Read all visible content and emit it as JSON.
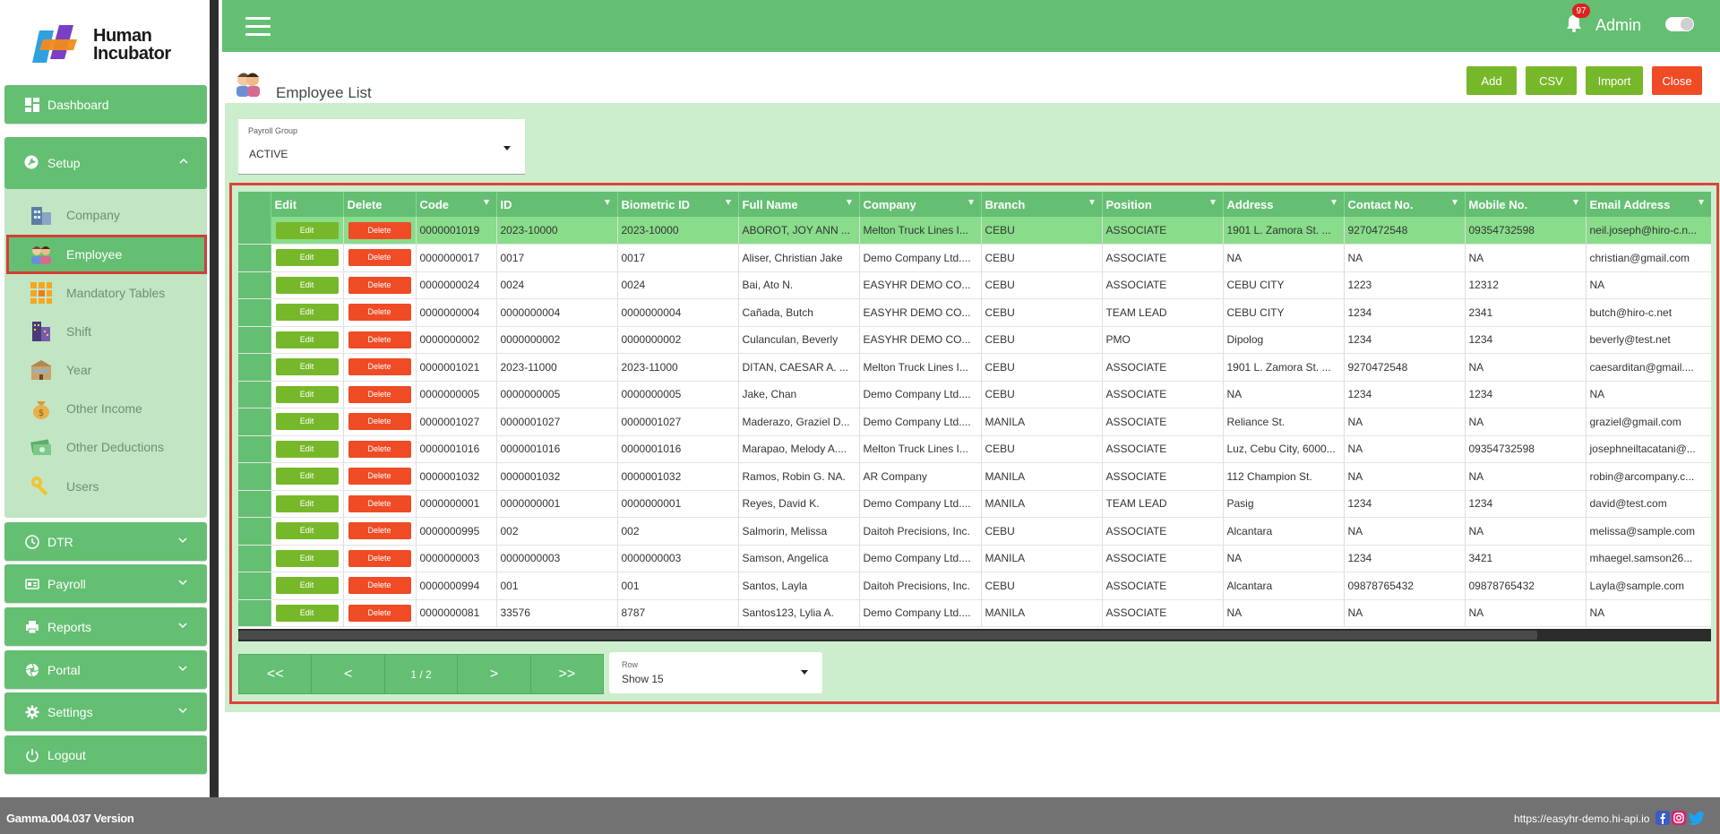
{
  "app": {
    "logo_line1": "Human",
    "logo_line2": "Incubator"
  },
  "sidebar": {
    "dashboard": "Dashboard",
    "setup": "Setup",
    "setup_items": [
      {
        "label": "Company",
        "icon": "building-icon"
      },
      {
        "label": "Employee",
        "icon": "people-icon"
      },
      {
        "label": "Mandatory Tables",
        "icon": "grid-tiles-icon"
      },
      {
        "label": "Shift",
        "icon": "shift-building-icon"
      },
      {
        "label": "Year",
        "icon": "calendar-building-icon"
      },
      {
        "label": "Other Income",
        "icon": "money-bag-icon"
      },
      {
        "label": "Other Deductions",
        "icon": "money-stack-icon"
      },
      {
        "label": "Users",
        "icon": "key-icon"
      }
    ],
    "dtr": "DTR",
    "payroll": "Payroll",
    "reports": "Reports",
    "portal": "Portal",
    "settings": "Settings",
    "logout": "Logout"
  },
  "topbar": {
    "notification_count": "97",
    "user": "Admin"
  },
  "page": {
    "title": "Employee List",
    "actions": {
      "add": "Add",
      "csv": "CSV",
      "import": "Import",
      "close": "Close"
    },
    "payroll_group_label": "Payroll Group",
    "payroll_group_value": "ACTIVE"
  },
  "grid": {
    "columns": [
      "Edit",
      "Delete",
      "Code",
      "ID",
      "Biometric ID",
      "Full Name",
      "Company",
      "Branch",
      "Position",
      "Address",
      "Contact No.",
      "Mobile No.",
      "Email Address"
    ],
    "edit_label": "Edit",
    "delete_label": "Delete",
    "selected_row": 0,
    "rows": [
      [
        "0000001019",
        "2023-10000",
        "2023-10000",
        "ABOROT, JOY ANN ...",
        "Melton Truck Lines I...",
        "CEBU",
        "ASSOCIATE",
        "1901 L. Zamora St. ...",
        "9270472548",
        "09354732598",
        "neil.joseph@hiro-c.n..."
      ],
      [
        "0000000017",
        "0017",
        "0017",
        "Aliser, Christian Jake",
        "Demo Company Ltd....",
        "CEBU",
        "ASSOCIATE",
        "NA",
        "NA",
        "NA",
        "christian@gmail.com"
      ],
      [
        "0000000024",
        "0024",
        "0024",
        "Bai, Ato N.",
        "EASYHR DEMO CO...",
        "CEBU",
        "ASSOCIATE",
        "CEBU CITY",
        "1223",
        "12312",
        "NA"
      ],
      [
        "0000000004",
        "0000000004",
        "0000000004",
        "Cañada, Butch",
        "EASYHR DEMO CO...",
        "CEBU",
        "TEAM LEAD",
        "CEBU CITY",
        "1234",
        "2341",
        "butch@hiro-c.net"
      ],
      [
        "0000000002",
        "0000000002",
        "0000000002",
        "Culanculan, Beverly",
        "EASYHR DEMO CO...",
        "CEBU",
        "PMO",
        "Dipolog",
        "1234",
        "1234",
        "beverly@test.net"
      ],
      [
        "0000001021",
        "2023-11000",
        "2023-11000",
        "DITAN, CAESAR A. ...",
        "Melton Truck Lines I...",
        "CEBU",
        "ASSOCIATE",
        "1901 L. Zamora St. ...",
        "9270472548",
        "NA",
        "caesarditan@gmail...."
      ],
      [
        "0000000005",
        "0000000005",
        "0000000005",
        "Jake, Chan",
        "Demo Company Ltd....",
        "CEBU",
        "ASSOCIATE",
        "NA",
        "1234",
        "1234",
        "NA"
      ],
      [
        "0000001027",
        "0000001027",
        "0000001027",
        "Maderazo, Graziel D...",
        "Demo Company Ltd....",
        "MANILA",
        "ASSOCIATE",
        "Reliance St.",
        "NA",
        "NA",
        "graziel@gmail.com"
      ],
      [
        "0000001016",
        "0000001016",
        "0000001016",
        "Marapao, Melody A....",
        "Melton Truck Lines I...",
        "CEBU",
        "ASSOCIATE",
        "Luz, Cebu City, 6000...",
        "NA",
        "09354732598",
        "josephneiltacatani@..."
      ],
      [
        "0000001032",
        "0000001032",
        "0000001032",
        "Ramos, Robin G. NA.",
        "AR Company",
        "MANILA",
        "ASSOCIATE",
        "112 Champion St.",
        "NA",
        "NA",
        "robin@arcompany.c..."
      ],
      [
        "0000000001",
        "0000000001",
        "0000000001",
        "Reyes, David K.",
        "Demo Company Ltd....",
        "MANILA",
        "TEAM LEAD",
        "Pasig",
        "1234",
        "1234",
        "david@test.com"
      ],
      [
        "0000000995",
        "002",
        "002",
        "Salmorin, Melissa",
        "Daitoh Precisions, Inc.",
        "CEBU",
        "ASSOCIATE",
        "Alcantara",
        "NA",
        "NA",
        "melissa@sample.com"
      ],
      [
        "0000000003",
        "0000000003",
        "0000000003",
        "Samson, Angelica",
        "Demo Company Ltd....",
        "MANILA",
        "ASSOCIATE",
        "NA",
        "1234",
        "3421",
        "mhaegel.samson26..."
      ],
      [
        "0000000994",
        "001",
        "001",
        "Santos, Layla",
        "Daitoh Precisions, Inc.",
        "CEBU",
        "ASSOCIATE",
        "Alcantara",
        "09878765432",
        "09878765432",
        "Layla@sample.com"
      ],
      [
        "0000000081",
        "33576",
        "8787",
        "Santos123, Lylia A.",
        "Demo Company Ltd....",
        "MANILA",
        "ASSOCIATE",
        "NA",
        "NA",
        "NA",
        "NA"
      ]
    ]
  },
  "pagination": {
    "first": "<<",
    "prev": "<",
    "info": "1 / 2",
    "next": ">",
    "last": ">>",
    "rows_label": "Row",
    "rows_value": "Show 15"
  },
  "footer": {
    "version": "Gamma.004.037 Version",
    "url": "https://easyhr-demo.hi-api.io"
  },
  "colors": {
    "primary_green": "#64bf72",
    "panel_green": "#cdeecd",
    "selected_row": "#88dc8a",
    "edit_button": "#77b82a",
    "delete_button": "#ef4b25",
    "highlight_outline": "#d9463c"
  }
}
